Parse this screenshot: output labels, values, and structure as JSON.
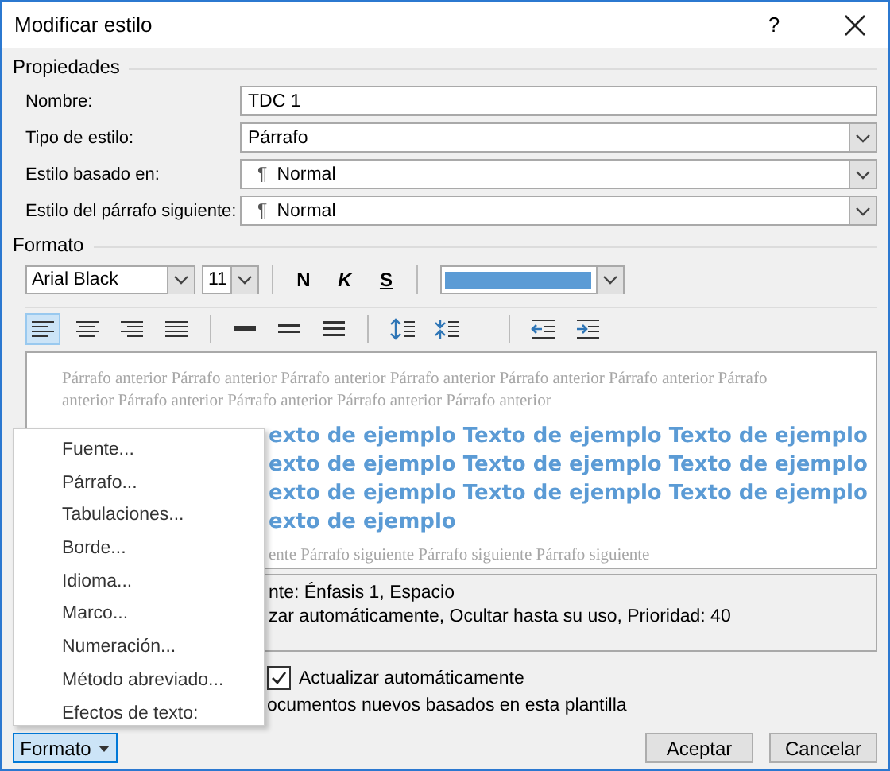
{
  "window": {
    "title": "Modificar estilo",
    "help": "?"
  },
  "properties": {
    "heading": "Propiedades",
    "fields": [
      {
        "label": "Nombre:",
        "kind": "text",
        "value": "TDC 1"
      },
      {
        "label": "Tipo de estilo:",
        "kind": "dropdown",
        "value": "Párrafo"
      },
      {
        "label": "Estilo basado en:",
        "kind": "dropdown",
        "prefix": "¶",
        "value": "Normal"
      },
      {
        "label": "Estilo del párrafo siguiente:",
        "kind": "dropdown",
        "prefix": "¶",
        "value": "Normal"
      }
    ]
  },
  "format": {
    "heading": "Formato",
    "font": "Arial Black",
    "size": "11",
    "styles": [
      "N",
      "K",
      "S"
    ],
    "color": "#5b9bd5",
    "alignment": [
      {
        "kind": "left",
        "selected": true
      },
      {
        "kind": "center",
        "selected": false
      },
      {
        "kind": "right",
        "selected": false
      },
      {
        "kind": "justify",
        "selected": false
      }
    ],
    "spacing": [
      {
        "kind": "single"
      },
      {
        "kind": "onehalf"
      },
      {
        "kind": "double"
      }
    ],
    "paragraph": [
      {
        "kind": "more"
      },
      {
        "kind": "less"
      }
    ],
    "indent": [
      {
        "kind": "decrease"
      },
      {
        "kind": "increase"
      }
    ]
  },
  "preview": {
    "previous": "Párrafo anterior Párrafo anterior Párrafo anterior Párrafo anterior Párrafo anterior Párrafo anterior Párrafo anterior Párrafo anterior Párrafo anterior Párrafo anterior Párrafo anterior",
    "sample": [
      "exto de ejemplo Texto de ejemplo Texto de ejemplo",
      "exto de ejemplo Texto de ejemplo Texto de ejemplo",
      "exto de ejemplo Texto de ejemplo Texto de ejemplo",
      "exto de ejemplo"
    ],
    "following": "ente Párrafo siguiente Párrafo siguiente Párrafo siguiente"
  },
  "description": [
    "nte: Énfasis 1, Espacio",
    "zar automáticamente, Ocultar hasta su uso, Prioridad: 40"
  ],
  "options": [
    {
      "kind": "checkbox",
      "label": "Actualizar automáticamente",
      "checked": true
    },
    {
      "kind": "text",
      "label": "ocumentos nuevos basados en esta plantilla"
    }
  ],
  "menu": {
    "items": [
      {
        "label": "Fuente..."
      },
      {
        "label": "Párrafo..."
      },
      {
        "label": "Tabulaciones..."
      },
      {
        "label": "Borde..."
      },
      {
        "label": "Idioma..."
      },
      {
        "label": "Marco..."
      },
      {
        "label": "Numeración..."
      },
      {
        "label": "Método abreviado..."
      },
      {
        "label": "Efectos de texto:"
      }
    ]
  },
  "buttons": [
    {
      "label": "Formato",
      "kind": "menu",
      "selected": true
    },
    {
      "label": "Aceptar",
      "kind": "plain",
      "selected": false
    },
    {
      "label": "Cancelar",
      "kind": "plain",
      "selected": false
    }
  ]
}
